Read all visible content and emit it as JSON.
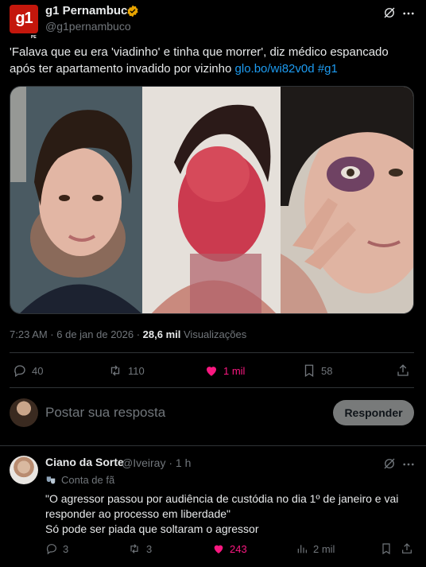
{
  "post": {
    "display_name": "g1 Pernambuco",
    "handle": "@g1pernambuco",
    "avatar_text": "g1",
    "avatar_sub": "PE",
    "text_main": "'Falava que eu era 'viadinho' e tinha que morrer', diz médico espancado após ter apartamento invadido por vizinho ",
    "text_link": "glo.bo/wi82v0d",
    "text_hashtag": "#g1",
    "time_date": "7:23 AM · 6 de jan de 2026 · ",
    "views_count": "28,6 mil",
    "views_label": "Visualizações",
    "counts": {
      "replies": "40",
      "reposts": "110",
      "likes": "1 mil",
      "bookmarks": "58"
    }
  },
  "composer": {
    "placeholder": "Postar sua resposta",
    "button": "Responder"
  },
  "reply": {
    "display_name": "Ciano da Sorte",
    "meta": "@Iveiray · 1 h",
    "badge": "Conta de fã",
    "lines": [
      "\"O agressor passou por audiência de custódia no dia 1º de janeiro e vai responder ao processo em liberdade\"",
      "Só pode ser piada que soltaram o agressor"
    ],
    "counts": {
      "replies": "3",
      "reposts": "3",
      "likes": "243",
      "views": "2 mil"
    }
  },
  "colors": {
    "background": "#000000",
    "link": "#1d9bf0",
    "like": "#f91880",
    "verified": "#e8a400",
    "muted": "#71767b"
  }
}
